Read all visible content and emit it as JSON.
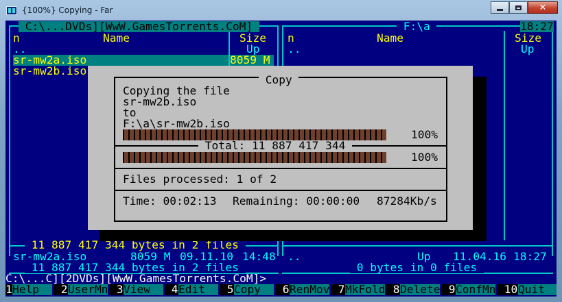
{
  "window": {
    "title": "{100%} Copying - Far",
    "controls": {
      "min": "minimize",
      "max": "maximize",
      "close": "✕"
    }
  },
  "left_panel": {
    "path": " C:\\...DVDs][WwW.GamesTorrents.CoM] ",
    "col_n": "n",
    "col_name": "Name",
    "col_size": "Size",
    "up_row": "..",
    "up_size": "Up",
    "files": [
      {
        "name": "sr-mw2a.iso",
        "size": "8059 M",
        "selected": true
      },
      {
        "name": "sr-mw2b.iso",
        "size": "",
        "selected": false
      }
    ],
    "selected_summary": " 11 887 417 344 bytes in 2 files ",
    "info_name": "sr-mw2a.iso",
    "info_size": "8059 M",
    "info_date": "09.11.10",
    "info_time": "14:48",
    "total_summary": " 11 887 417 344 bytes in 2 files "
  },
  "right_panel": {
    "path": " F:\\a ",
    "clock": "18:27",
    "col_n": "n",
    "col_name": "Name",
    "col_size": "Size",
    "up_row": "..",
    "up_size": "Up",
    "info_name": "..",
    "info_size": "Up",
    "info_date": "11.04.16",
    "info_time": "18:27",
    "total_summary": " 0 bytes in 0 files "
  },
  "dialog": {
    "title": " Copy ",
    "line1": "Copying the file",
    "source": "sr-mw2b.iso",
    "to": "to",
    "dest": "F:\\a\\sr-mw2b.iso",
    "file_progress": 1.0,
    "file_percent": "100%",
    "total_label": " Total: 11 887 417 344 ",
    "total_progress": 1.0,
    "total_percent": "100%",
    "files_processed": "Files processed: 1 of 2",
    "time": "Time: 00:02:13",
    "remaining": "Remaining: 00:00:00",
    "speed": "87284Kb/s"
  },
  "cmdline": "C:\\...C][2DVDs][WwW.GamesTorrents.CoM]>",
  "keybar": [
    {
      "num": "1",
      "label": "Help  "
    },
    {
      "num": " 2",
      "label": "UserMn"
    },
    {
      "num": " 3",
      "label": "View  "
    },
    {
      "num": " 4",
      "label": "Edit  "
    },
    {
      "num": " 5",
      "label": "Copy  "
    },
    {
      "num": " 6",
      "label": "RenMov"
    },
    {
      "num": " 7",
      "label": "MkFold"
    },
    {
      "num": " 8",
      "label": "Delete"
    },
    {
      "num": " 9",
      "label": "ConfMn"
    },
    {
      "num": " 10",
      "label": "Quit  "
    }
  ]
}
